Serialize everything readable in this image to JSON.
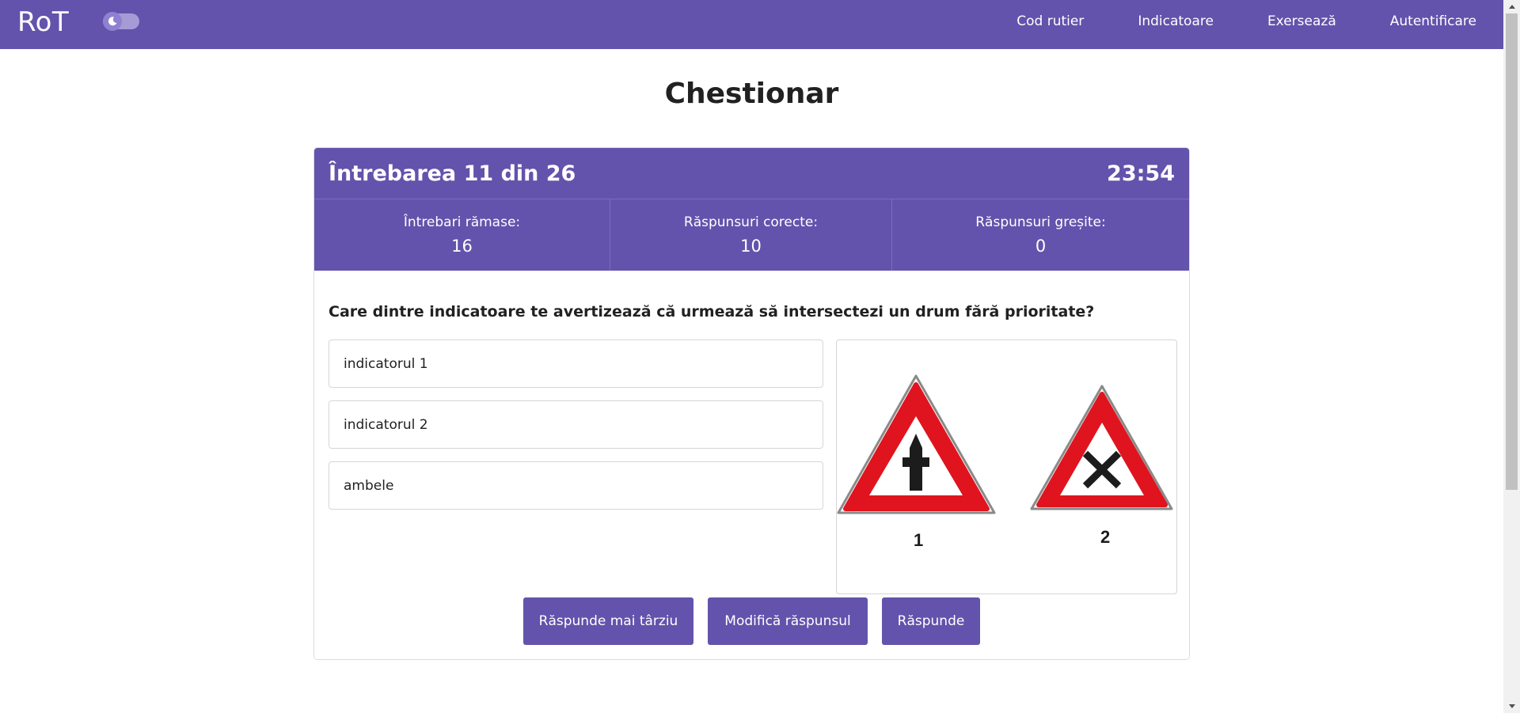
{
  "nav": {
    "brand": "RoT",
    "links": [
      "Cod rutier",
      "Indicatoare",
      "Exersează",
      "Autentificare"
    ]
  },
  "page": {
    "title": "Chestionar"
  },
  "quiz": {
    "counter": "Întrebarea 11 din 26",
    "timer": "23:54",
    "stats": [
      {
        "label": "Întrebari rămase:",
        "value": "16"
      },
      {
        "label": "Răspunsuri corecte:",
        "value": "10"
      },
      {
        "label": "Răspunsuri greșite:",
        "value": "0"
      }
    ],
    "question": "Care dintre indicatoare te avertizează că urmează să intersectezi un drum fără prioritate?",
    "answers": [
      "indicatorul 1",
      "indicatorul 2",
      "ambele"
    ],
    "image": {
      "sign1_number": "1",
      "sign2_number": "2"
    },
    "buttons": {
      "later": "Răspunde mai târziu",
      "modify": "Modifică răspunsul",
      "answer": "Răspunde"
    }
  },
  "colors": {
    "accent": "#6353ac",
    "sign_red": "#e0141e"
  }
}
